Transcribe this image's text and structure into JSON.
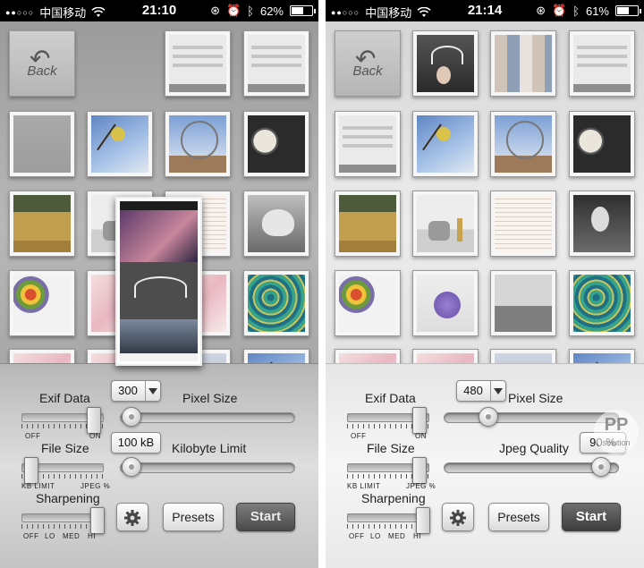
{
  "left": {
    "status": {
      "carrier": "中国移动",
      "time": "21:10",
      "battery": "62%",
      "battery_level": 0.62
    },
    "panel": {
      "exif_label": "Exif Data",
      "pixel_size_label": "Pixel Size",
      "pixel_size_value": "300",
      "off_label": "OFF",
      "on_label": "ON",
      "file_size_label": "File Size",
      "limit_value": "100 kB",
      "limit_label": "Kilobyte Limit",
      "kb_limit_label": "KB LIMIT",
      "jpeg_pct_label": "JPEG %",
      "sharpening_label": "Sharpening",
      "sharp_off": "OFF",
      "sharp_lo": "LO",
      "sharp_med": "MED",
      "sharp_hi": "HI",
      "presets_label": "Presets",
      "start_label": "Start",
      "exif_state": "on",
      "file_size_mode": "kb-limit",
      "sharpening_level": "HI",
      "pixel_slider": 0.06,
      "limit_slider": 0.06
    }
  },
  "right": {
    "status": {
      "carrier": "中国移动",
      "time": "21:14",
      "battery": "61%",
      "battery_level": 0.61
    },
    "panel": {
      "exif_label": "Exif Data",
      "pixel_size_label": "Pixel Size",
      "pixel_size_value": "480",
      "off_label": "OFF",
      "on_label": "ON",
      "file_size_label": "File Size",
      "quality_label": "Jpeg Quality",
      "quality_value": "90 %",
      "kb_limit_label": "KB LIMIT",
      "jpeg_pct_label": "JPEG %",
      "sharpening_label": "Sharpening",
      "sharp_off": "OFF",
      "sharp_lo": "LO",
      "sharp_med": "MED",
      "sharp_hi": "HI",
      "presets_label": "Presets",
      "start_label": "Start",
      "exif_state": "on",
      "file_size_mode": "jpeg-percent",
      "sharpening_level": "HI",
      "pixel_slider": 0.25,
      "quality_slider": 0.9
    },
    "watermark": {
      "main": "PP",
      "sub": "solution"
    }
  },
  "gallery_back_label": "Back",
  "colors": {
    "accent_dark": "#4a4a4a",
    "panel_light": "#f6f6f6"
  }
}
